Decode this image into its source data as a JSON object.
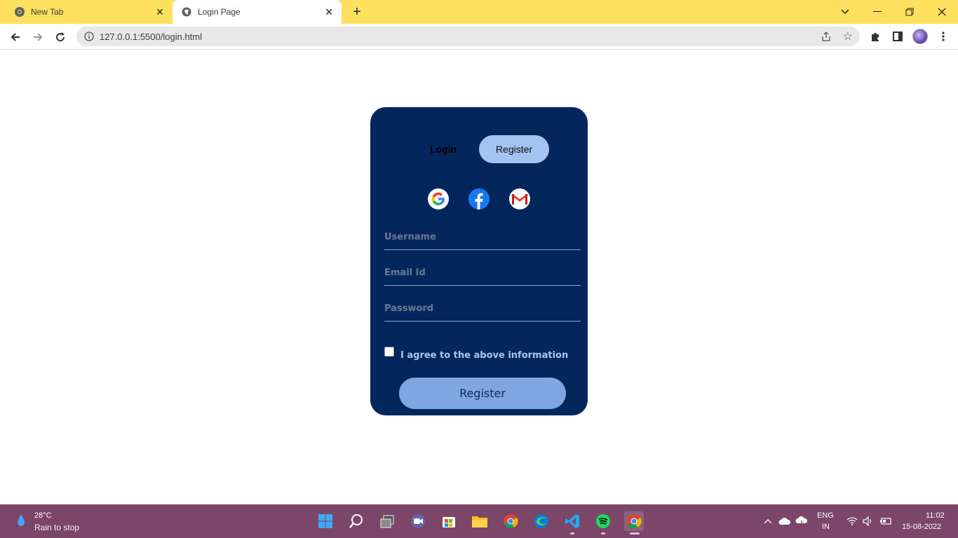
{
  "browser": {
    "tabs": [
      {
        "title": "New Tab"
      },
      {
        "title": "Login Page"
      }
    ],
    "url": "127.0.0.1:5500/login.html"
  },
  "form": {
    "tab_login": "Login",
    "tab_register": "Register",
    "username_placeholder": "Username",
    "email_placeholder": "Email Id",
    "password_placeholder": "Password",
    "agree_label": "I agree to the above information",
    "submit_label": "Register",
    "social_icons": [
      "google-icon",
      "facebook-icon",
      "gmail-icon"
    ]
  },
  "taskbar": {
    "weather_temp": "28°C",
    "weather_desc": "Rain to stop",
    "lang": "ENG",
    "region": "IN",
    "time": "11:02",
    "date": "15-08-2022"
  },
  "colors": {
    "tabbar": "#fde05d",
    "card": "#03275c",
    "accent": "#a4c3f0",
    "button": "#7fa6e0",
    "taskbar": "#7b4668"
  }
}
